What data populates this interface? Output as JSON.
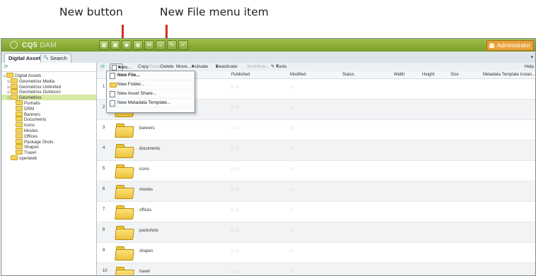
{
  "annotations": {
    "new_button": "New button",
    "new_file_menu_item": "New File menu item",
    "color": "#d62a1f"
  },
  "app": {
    "logo": "CQ5",
    "logo_suffix": "DAM",
    "admin_label": "Administrator"
  },
  "tabs": {
    "active": "Digital Assets",
    "search": "Search"
  },
  "tree": {
    "root": "Digital Assets",
    "items": [
      "Geometrixx Media",
      "Geometrixx Unlimited",
      "Geometrixx Outdoors",
      "Geometrixx"
    ],
    "children": [
      "Portraits",
      "DRM",
      "Banners",
      "Documents",
      "Icons",
      "Movies",
      "Offices",
      "Package Shots",
      "Shapes",
      "Travel"
    ],
    "extra": "openweb"
  },
  "toolbar": {
    "new_label": "New...",
    "copy": "Copy",
    "paste": "Paste",
    "delete": "Delete",
    "move": "Move...",
    "activate": "Activate",
    "deactivate": "Deactivate",
    "workflow": "Workflow...",
    "tools": "Tools",
    "help": "Help"
  },
  "columns": {
    "published": "Published",
    "modified": "Modified",
    "status": "Status",
    "width": "Width",
    "height": "Height",
    "size": "Size",
    "meta": "Metadata Template Instan..."
  },
  "rows": [
    {
      "num": "1",
      "name": "",
      "pub": "□ □",
      "mod": "□"
    },
    {
      "num": "2",
      "name": "",
      "pub": "□ □",
      "mod": "□"
    },
    {
      "num": "3",
      "name": "banners",
      "pub": "□ □",
      "mod": "□"
    },
    {
      "num": "4",
      "name": "documents",
      "pub": "□ □",
      "mod": "□"
    },
    {
      "num": "5",
      "name": "icons",
      "pub": "□ □",
      "mod": "□"
    },
    {
      "num": "6",
      "name": "movies",
      "pub": "□ □",
      "mod": "□"
    },
    {
      "num": "7",
      "name": "offices",
      "pub": "□ □",
      "mod": "□"
    },
    {
      "num": "8",
      "name": "packshots",
      "pub": "□ □",
      "mod": "□"
    },
    {
      "num": "9",
      "name": "shapes",
      "pub": "□ □",
      "mod": "□"
    },
    {
      "num": "10",
      "name": "travel",
      "pub": "□ □",
      "mod": "□"
    }
  ],
  "menu": {
    "new_file": "New File...",
    "new_folder": "New Folder...",
    "new_asset_share": "New Asset Share...",
    "new_metadata_template": "New Metadata Template..."
  }
}
